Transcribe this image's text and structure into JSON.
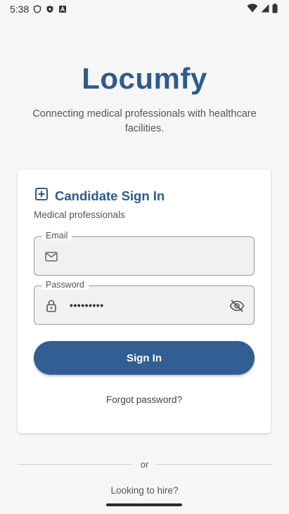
{
  "status_bar": {
    "time": "5:38",
    "left_icons": [
      "shield-icon",
      "shield-filled-icon",
      "text-a-icon"
    ],
    "right_icons": [
      "wifi-icon",
      "cellular-icon",
      "battery-icon"
    ]
  },
  "app": {
    "title": "Locumfy",
    "subtitle": "Connecting medical professionals with healthcare facilities."
  },
  "card": {
    "icon": "add-box-icon",
    "title": "Candidate Sign In",
    "subtitle": "Medical professionals",
    "email": {
      "label": "Email",
      "value": "",
      "icon": "mail-icon"
    },
    "password": {
      "label": "Password",
      "value": "•••••••••",
      "icon": "lock-icon",
      "toggle_icon": "visibility-off-icon"
    },
    "signin_label": "Sign In",
    "forgot_label": "Forgot password?"
  },
  "divider_text": "or",
  "hire_link": "Looking to hire?",
  "colors": {
    "brand": "#2e5b8f",
    "button": "#315f94",
    "background": "#f6f6f6"
  }
}
